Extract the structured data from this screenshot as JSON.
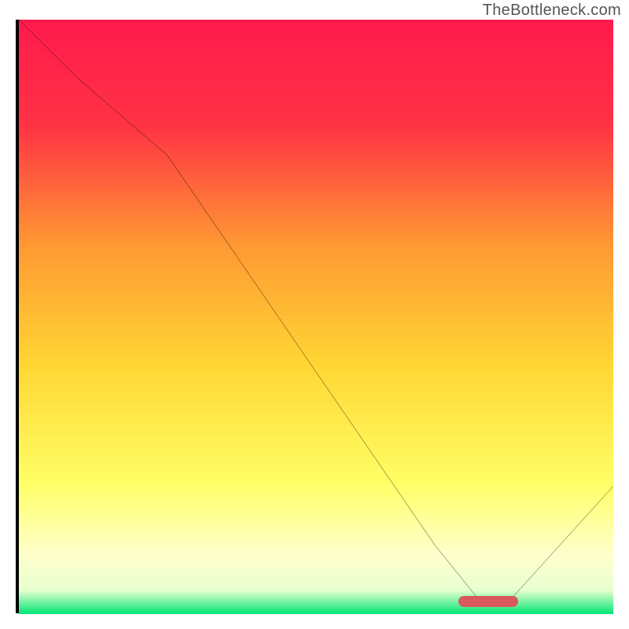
{
  "watermark": "TheBottleneck.com",
  "colors": {
    "gradient_top": "#ff1a4d",
    "gradient_upper": "#ff6633",
    "gradient_mid": "#ffcc33",
    "gradient_lower": "#ffff99",
    "gradient_pale": "#f8ffe0",
    "gradient_bottom": "#00e676",
    "curve": "#000000",
    "marker": "#d85a5a",
    "axis": "#000000"
  },
  "chart_data": {
    "type": "line",
    "title": "",
    "xlabel": "",
    "ylabel": "",
    "xlim": [
      0,
      100
    ],
    "ylim": [
      0,
      100
    ],
    "series": [
      {
        "name": "bottleneck-curve",
        "x": [
          0,
          10,
          25,
          70,
          78,
          82,
          100
        ],
        "y": [
          100,
          90,
          77,
          11,
          1,
          1,
          21
        ]
      }
    ],
    "marker_region": {
      "x_start": 74,
      "x_end": 84,
      "y": 0.5
    },
    "axes_visible": {
      "left": true,
      "bottom": true,
      "top": false,
      "right": false
    },
    "grid": false,
    "legend": false
  }
}
